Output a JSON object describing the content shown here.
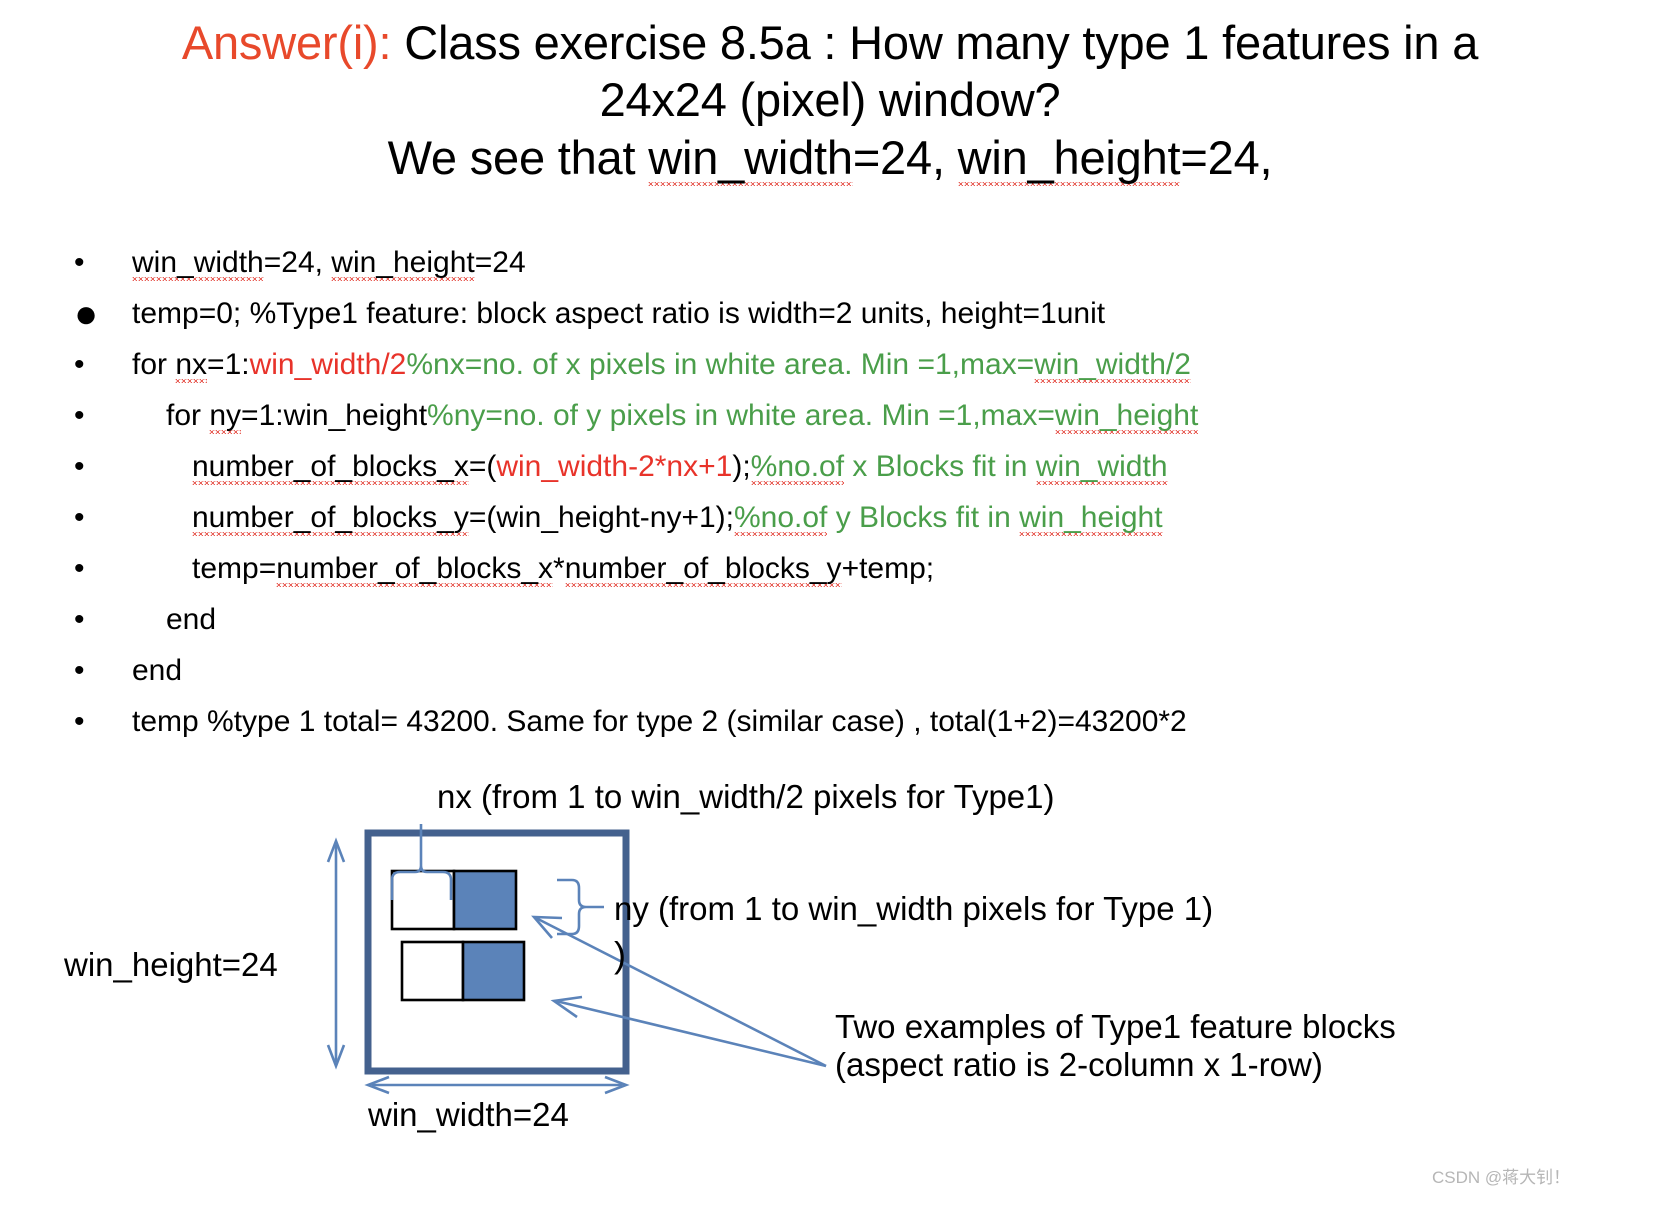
{
  "slide": {
    "title": {
      "answer_label": "Answer(i):",
      "line1_rest": " Class exercise 8.5a : How many type 1 features in a",
      "line2": "24x24 (pixel) window?",
      "line3_a": "We see that ",
      "line3_b": "win_width",
      "line3_c": "=24, ",
      "line3_d": "win_height",
      "line3_e": "=24,"
    },
    "bullets": [
      {
        "marker": "•",
        "marker_size": "small",
        "indent": "ind1",
        "segments": [
          {
            "text": "win_width",
            "color": "black",
            "squiggle": true
          },
          {
            "text": "=24, ",
            "color": "black",
            "squiggle": false
          },
          {
            "text": "win_height",
            "color": "black",
            "squiggle": true
          },
          {
            "text": "=24",
            "color": "black",
            "squiggle": false
          }
        ]
      },
      {
        "marker": "●",
        "marker_size": "big",
        "indent": "ind1",
        "segments": [
          {
            "text": "temp=0; %Type1 feature: block aspect ratio is width=2 units, height=1unit",
            "color": "black",
            "squiggle": false
          }
        ]
      },
      {
        "marker": "•",
        "marker_size": "small",
        "indent": "ind1",
        "segments": [
          {
            "text": "for ",
            "color": "black",
            "squiggle": false
          },
          {
            "text": "nx",
            "color": "black",
            "squiggle": true
          },
          {
            "text": "=1:",
            "color": "black",
            "squiggle": false
          },
          {
            "text": "win_width/2",
            "color": "red",
            "squiggle": false
          },
          {
            "text": "%nx=no. of x pixels in white area. Min =1,max=",
            "color": "green",
            "squiggle": false
          },
          {
            "text": "win_width/2",
            "color": "green",
            "squiggle": true
          }
        ]
      },
      {
        "marker": "•",
        "marker_size": "small",
        "indent": "ind2",
        "segments": [
          {
            "text": "for ",
            "color": "black",
            "squiggle": false
          },
          {
            "text": "ny",
            "color": "black",
            "squiggle": true
          },
          {
            "text": "=1:win_height",
            "color": "black",
            "squiggle": false
          },
          {
            "text": "%ny=no. of y pixels in white area. Min =1,max=",
            "color": "green",
            "squiggle": false
          },
          {
            "text": "win_height",
            "color": "green",
            "squiggle": true
          }
        ]
      },
      {
        "marker": "•",
        "marker_size": "small",
        "indent": "ind3",
        "segments": [
          {
            "text": "number_of_blocks_x",
            "color": "black",
            "squiggle": true
          },
          {
            "text": "=(",
            "color": "black",
            "squiggle": false
          },
          {
            "text": "win_width-2*nx+1",
            "color": "red",
            "squiggle": false
          },
          {
            "text": ");",
            "color": "black",
            "squiggle": false
          },
          {
            "text": "%no.of",
            "color": "green",
            "squiggle": true
          },
          {
            "text": " x Blocks fit in ",
            "color": "green",
            "squiggle": false
          },
          {
            "text": "win_width",
            "color": "green",
            "squiggle": true
          }
        ]
      },
      {
        "marker": "•",
        "marker_size": "small",
        "indent": "ind3",
        "segments": [
          {
            "text": "number_of_blocks_y",
            "color": "black",
            "squiggle": true
          },
          {
            "text": "=(win_height-ny+1);",
            "color": "black",
            "squiggle": false
          },
          {
            "text": "%no.of",
            "color": "green",
            "squiggle": true
          },
          {
            "text": " y Blocks fit in ",
            "color": "green",
            "squiggle": false
          },
          {
            "text": "win_height",
            "color": "green",
            "squiggle": true
          }
        ]
      },
      {
        "marker": "•",
        "marker_size": "small",
        "indent": "ind3",
        "segments": [
          {
            "text": "temp=",
            "color": "black",
            "squiggle": false
          },
          {
            "text": "number_of_blocks_x",
            "color": "black",
            "squiggle": true
          },
          {
            "text": "*",
            "color": "black",
            "squiggle": false
          },
          {
            "text": "number_of_blocks_y",
            "color": "black",
            "squiggle": true
          },
          {
            "text": "+temp;",
            "color": "black",
            "squiggle": false
          }
        ]
      },
      {
        "marker": "•",
        "marker_size": "small",
        "indent": "ind2",
        "segments": [
          {
            "text": "end",
            "color": "black",
            "squiggle": false
          }
        ]
      },
      {
        "marker": "•",
        "marker_size": "small",
        "indent": "ind1",
        "segments": [
          {
            "text": "end",
            "color": "black",
            "squiggle": false
          }
        ]
      },
      {
        "marker": "•",
        "marker_size": "small",
        "indent": "ind1",
        "segments": [
          {
            "text": "temp %type 1 total= 43200. Same for type 2 (similar case) , total(1+2)=43200*2",
            "color": "black",
            "squiggle": false
          }
        ]
      }
    ],
    "diagram": {
      "nx_label": "nx (from 1 to win_width/2 pixels for Type1)",
      "ny_label": "ny (from 1 to win_width pixels for Type 1)",
      "stray_paren": ")",
      "win_height_label": "win_height=24",
      "win_width_label": "win_width=24",
      "examples_caption_line1": "Two examples of Type1 feature blocks",
      "examples_caption_line2": "(aspect ratio is 2-column x 1-row)",
      "colors": {
        "window_border": "#44618E",
        "block_fill": "#5B83B9",
        "block_border": "#000000",
        "annotation": "#5B83B9"
      }
    },
    "watermark": "CSDN @蒋大钊！"
  }
}
